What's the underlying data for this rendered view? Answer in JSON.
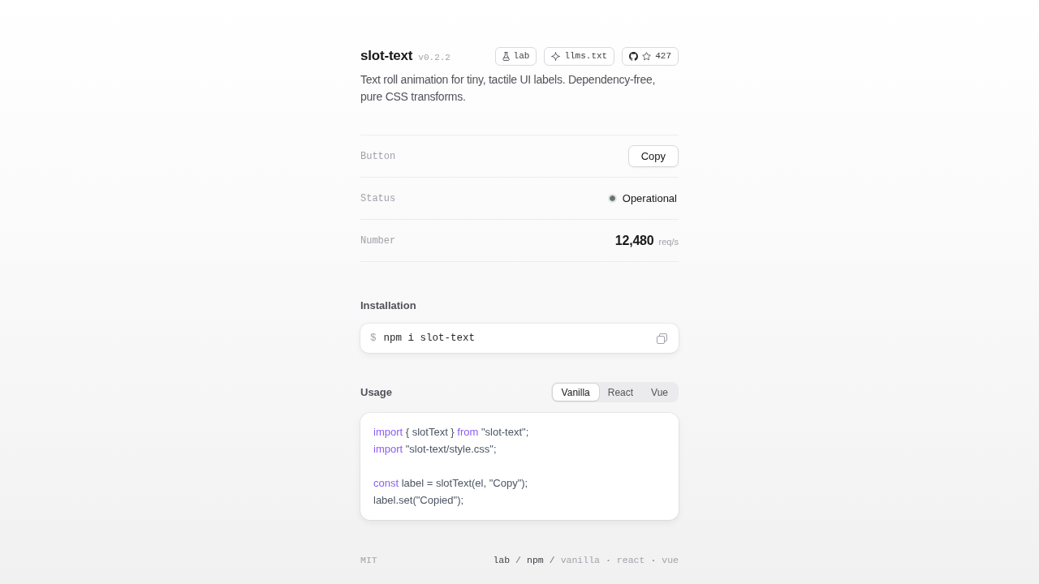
{
  "header": {
    "title": "slot-text",
    "version": "v0.2.2",
    "links": [
      {
        "kind": "lab",
        "label": "lab"
      },
      {
        "kind": "llms",
        "label": "llms.txt"
      },
      {
        "kind": "github",
        "label": "427"
      }
    ],
    "description": "Text roll animation for tiny, tactile UI labels. Dependency-free, pure CSS transforms."
  },
  "demos": [
    {
      "kind": "button",
      "label": "Button",
      "value": "Copy"
    },
    {
      "kind": "status",
      "label": "Status",
      "value": "Operational",
      "color": "#66736f"
    },
    {
      "kind": "number",
      "label": "Number",
      "value": "12,480",
      "unit": "req/s"
    }
  ],
  "installation": {
    "title": "Installation",
    "prompt": "$",
    "command": "npm i slot-text"
  },
  "usage": {
    "title": "Usage",
    "tabs": [
      {
        "label": "Vanilla",
        "selected": true
      },
      {
        "label": "React",
        "selected": false
      },
      {
        "label": "Vue",
        "selected": false
      }
    ],
    "code": [
      [
        [
          {
            "kind": "keyword",
            "text": "import"
          },
          {
            "kind": "plain",
            "text": " { slotText } "
          },
          {
            "kind": "keyword",
            "text": "from"
          },
          {
            "kind": "plain",
            "text": " \"slot-text\";"
          }
        ],
        [
          {
            "kind": "keyword",
            "text": "import"
          },
          {
            "kind": "plain",
            "text": " \"slot-text/style.css\";"
          }
        ]
      ],
      [
        [
          {
            "kind": "keyword",
            "text": "const"
          },
          {
            "kind": "plain",
            "text": " label = slotText(el, \"Copy\");"
          }
        ],
        [
          {
            "kind": "plain",
            "text": "label.set(\"Copied\");"
          }
        ]
      ]
    ]
  },
  "footer": {
    "license": "MIT",
    "links": [
      {
        "kind": "primary",
        "text": "lab"
      },
      {
        "kind": "separator",
        "text": "/"
      },
      {
        "kind": "primary",
        "text": "npm"
      },
      {
        "kind": "separator",
        "text": "/"
      },
      {
        "kind": "secondary",
        "text": "vanilla"
      },
      {
        "kind": "separator",
        "text": "·"
      },
      {
        "kind": "secondary",
        "text": "react"
      },
      {
        "kind": "separator",
        "text": "·"
      },
      {
        "kind": "secondary",
        "text": "vue"
      }
    ]
  }
}
